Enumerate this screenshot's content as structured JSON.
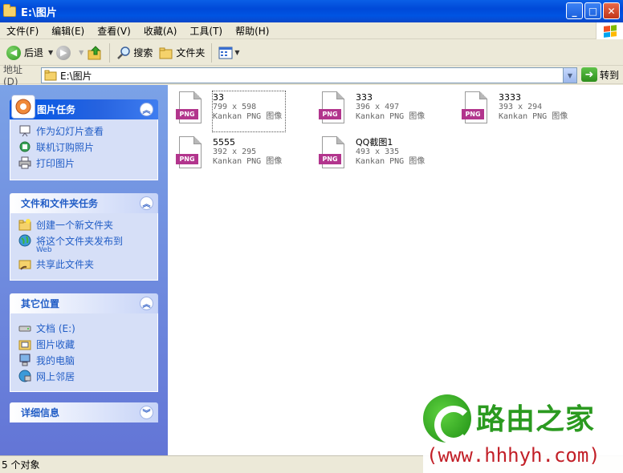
{
  "window": {
    "title": "E:\\图片"
  },
  "menu": [
    "文件(F)",
    "编辑(E)",
    "查看(V)",
    "收藏(A)",
    "工具(T)",
    "帮助(H)"
  ],
  "toolbar": {
    "back": "后退",
    "search": "搜索",
    "folders": "文件夹"
  },
  "address": {
    "label": "地址(D)",
    "path": "E:\\图片",
    "go": "转到"
  },
  "tasks": {
    "picture": {
      "title": "图片任务",
      "items": [
        "作为幻灯片查看",
        "联机订购照片",
        "打印图片"
      ]
    },
    "file": {
      "title": "文件和文件夹任务",
      "items": [
        "创建一个新文件夹",
        "将这个文件夹发布到",
        "共享此文件夹"
      ],
      "web_sub": "Web"
    },
    "other": {
      "title": "其它位置",
      "items": [
        "文档 (E:)",
        "图片收藏",
        "我的电脑",
        "网上邻居"
      ]
    },
    "details": {
      "title": "详细信息"
    }
  },
  "files": [
    {
      "name": "33",
      "dims": "799 x 598",
      "type": "Kankan PNG 图像",
      "tag": "PNG"
    },
    {
      "name": "333",
      "dims": "396 x 497",
      "type": "Kankan PNG 图像",
      "tag": "PNG"
    },
    {
      "name": "3333",
      "dims": "393 x 294",
      "type": "Kankan PNG 图像",
      "tag": "PNG"
    },
    {
      "name": "5555",
      "dims": "392 x 295",
      "type": "Kankan PNG 图像",
      "tag": "PNG"
    },
    {
      "name": "QQ截图1",
      "dims": "493 x 335",
      "type": "Kankan PNG 图像",
      "tag": "PNG"
    }
  ],
  "status": {
    "left": "5 个对象"
  },
  "watermark": {
    "brand": "路由之家",
    "url": "(www.hhhyh.com)"
  },
  "colors": {
    "titlebar": "#0054e3",
    "taskpane": "#6375d6",
    "link": "#215dc6",
    "png_tag": "#b2358d",
    "watermark_green": "#2b9a20",
    "watermark_red": "#c21f27"
  }
}
